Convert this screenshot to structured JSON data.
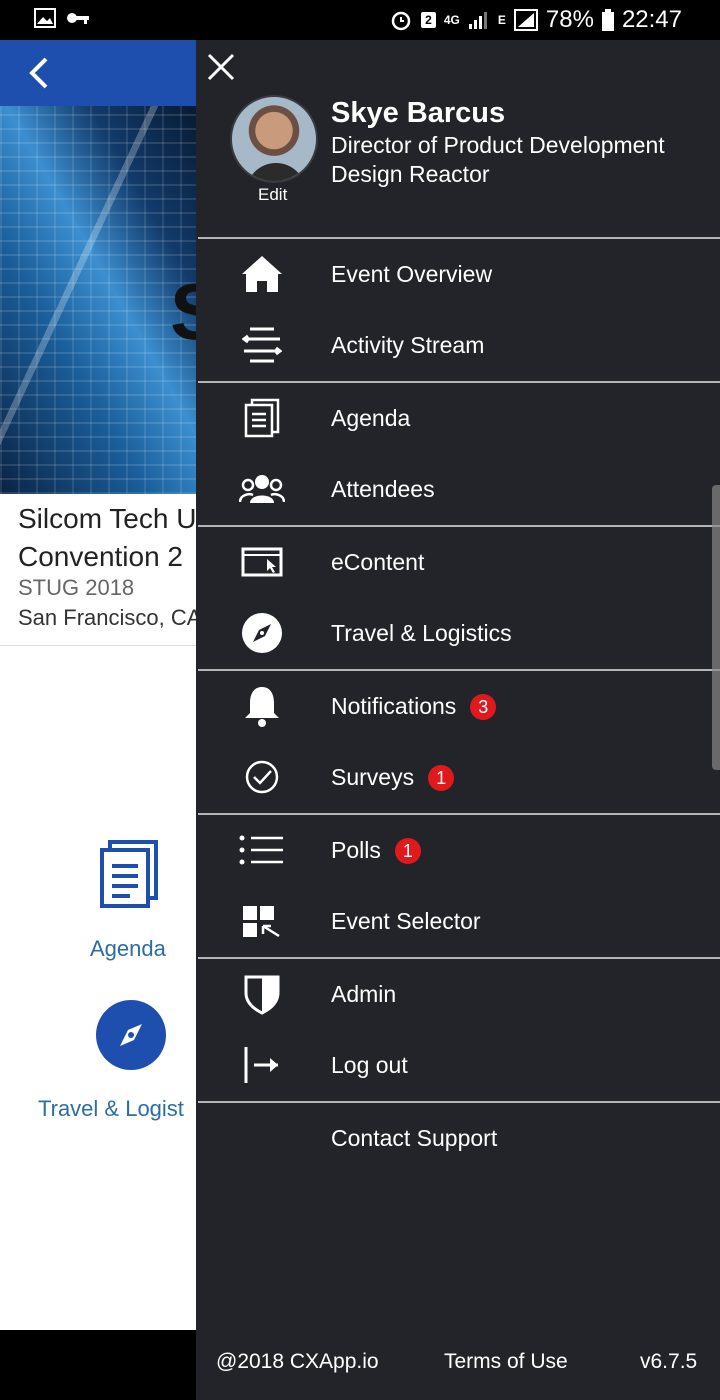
{
  "status_bar": {
    "battery": "78%",
    "time": "22:47",
    "sim_slot": "2",
    "network_4g": "4G",
    "network_e": "E"
  },
  "background_page": {
    "title_line1": "Silcom Tech U",
    "title_line2": "Convention 2",
    "subtitle": "STUG 2018",
    "location": "San Francisco, CA",
    "hero_letter": "S",
    "tile_agenda": "Agenda",
    "tile_travel": "Travel & Logist"
  },
  "profile": {
    "name": "Skye Barcus",
    "role": "Director of Product Development",
    "company": "Design Reactor",
    "edit_label": "Edit"
  },
  "menu": {
    "items": [
      {
        "label": "Event Overview",
        "icon": "home-icon"
      },
      {
        "label": "Activity Stream",
        "icon": "activity-stream-icon"
      },
      {
        "label": "Agenda",
        "icon": "agenda-icon"
      },
      {
        "label": "Attendees",
        "icon": "attendees-icon"
      },
      {
        "label": "eContent",
        "icon": "econtent-icon"
      },
      {
        "label": "Travel & Logistics",
        "icon": "compass-icon"
      },
      {
        "label": "Notifications",
        "icon": "bell-icon",
        "badge": "3"
      },
      {
        "label": "Surveys",
        "icon": "check-circle-icon",
        "badge": "1"
      },
      {
        "label": "Polls",
        "icon": "list-icon",
        "badge": "1"
      },
      {
        "label": "Event Selector",
        "icon": "event-selector-icon"
      },
      {
        "label": "Admin",
        "icon": "shield-icon"
      },
      {
        "label": "Log out",
        "icon": "logout-icon"
      },
      {
        "label": "Contact Support",
        "icon": ""
      }
    ]
  },
  "footer": {
    "copyright": "@2018 CXApp.io",
    "terms": "Terms of Use",
    "version": "v6.7.5"
  },
  "colors": {
    "drawer_bg": "#232429",
    "header_blue": "#1f4fae",
    "badge_red": "#e0191c",
    "link_blue": "#2a6da8"
  }
}
